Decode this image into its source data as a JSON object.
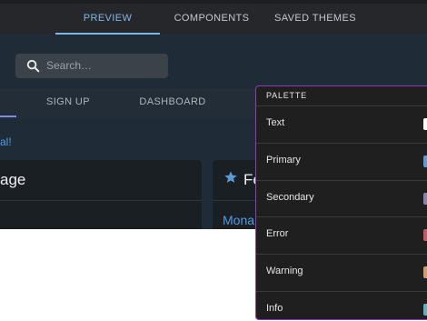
{
  "top_tabs": [
    "PREVIEW",
    "COMPONENTS",
    "SAVED THEMES"
  ],
  "search": {
    "placeholder": "Search…"
  },
  "app_tabs": [
    "SIGN UP",
    "DASHBOARD"
  ],
  "alert_text": "al!",
  "card_a": {
    "title": "age"
  },
  "card_b": {
    "title": "Fe",
    "link": "Mona"
  },
  "palette": {
    "title": "PALETTE",
    "rows": [
      {
        "label": "Text",
        "color": "#ffffff"
      },
      {
        "label": "Primary",
        "color": "#5b9bd5"
      },
      {
        "label": "Secondary",
        "color": "#8d7fb0"
      },
      {
        "label": "Error",
        "color": "#c75b5f"
      },
      {
        "label": "Warning",
        "color": "#d39a63"
      },
      {
        "label": "Info",
        "color": "#5bb3c4"
      }
    ]
  },
  "icons": {
    "search": "search-icon",
    "star": "star-icon"
  }
}
